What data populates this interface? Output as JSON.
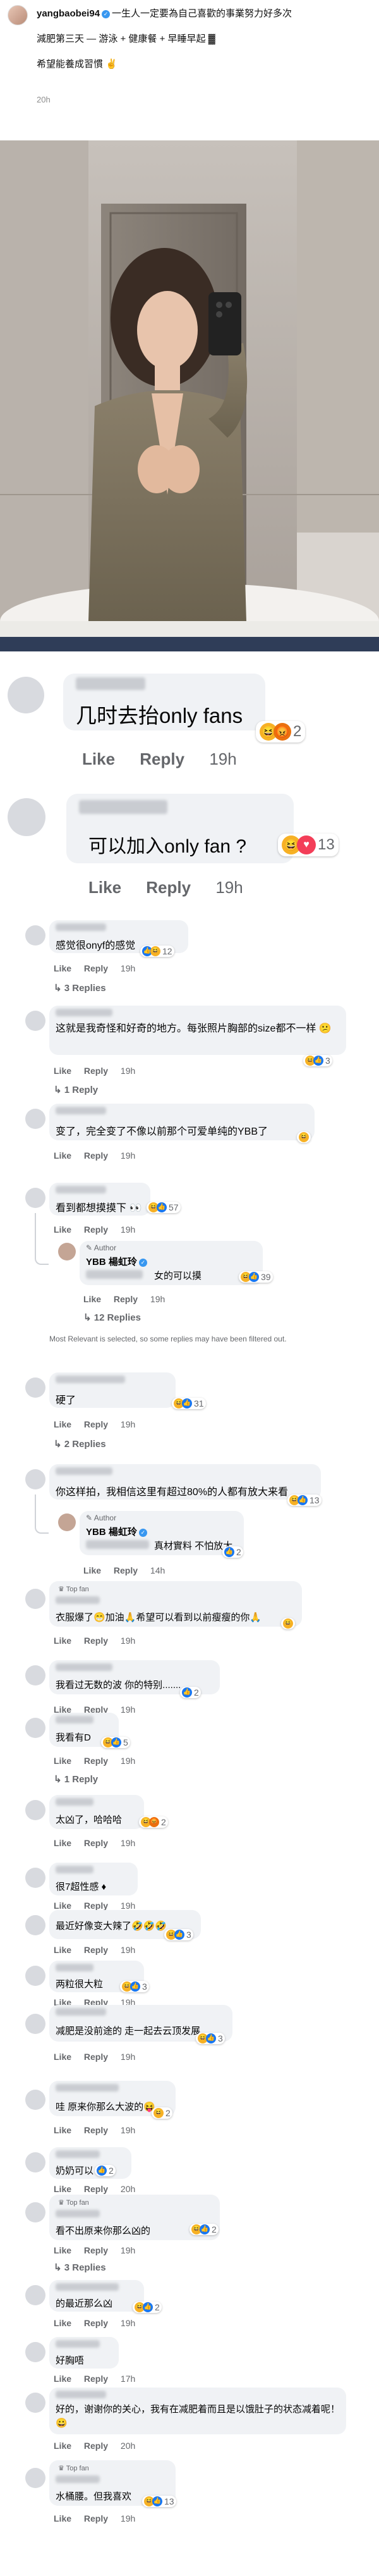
{
  "instagram_post": {
    "username": "yangbaobei94",
    "caption_line1": "一生人一定要為自己喜歡的事業努力好多次",
    "caption_line2": "減肥第三天 — 游泳 + 健康餐 + 早睡早起 ▓",
    "caption_line3": "希望能養成習慣 ✌",
    "time": "20h"
  },
  "labels": {
    "like": "Like",
    "reply": "Reply"
  },
  "comments": [
    {
      "text": "几时去抬only fans",
      "time": "19h",
      "count": "2"
    },
    {
      "text": "可以加入only fan ?",
      "time": "19h",
      "count": "13"
    },
    {
      "text": "感觉很onyf的感觉",
      "time": "19h",
      "count": "12",
      "replies": "3 Replies"
    },
    {
      "text": "这就是我奇怪和好奇的地方。每张照片胸部的size都不一样 😕",
      "time": "19h",
      "count": "3",
      "replies": "1 Reply"
    },
    {
      "text": "变了，完全变了不像以前那个可爱单纯的YBB了",
      "time": "19h",
      "count": ""
    },
    {
      "text": "看到都想摸摸下 👀",
      "time": "19h",
      "count": "57"
    },
    {
      "author": "Author",
      "name": "YBB 楊虹玲",
      "text": "女的可以摸",
      "time": "19h",
      "count": "39",
      "replies": "12 Replies"
    },
    {
      "note": "Most Relevant is selected, so some replies may have been filtered out."
    },
    {
      "text": "硬了",
      "time": "19h",
      "count": "31",
      "replies": "2 Replies"
    },
    {
      "text": "你这样拍，我相信这里有超过80%的人都有放大来看",
      "time": "19h",
      "count": "13"
    },
    {
      "author": "Author",
      "name": "YBB 楊虹玲",
      "text": "真材實料 不怕放大",
      "time": "14h",
      "count": "2"
    },
    {
      "badge": "Top fan",
      "text": "衣服爆了😁加油🙏希望可以看到以前瘦瘦的你🙏",
      "time": "19h",
      "count": ""
    },
    {
      "text": "我看过无数的波 你的特别.......",
      "time": "19h",
      "count": "2"
    },
    {
      "text": "我看有D",
      "time": "19h",
      "count": "5",
      "replies": "1 Reply"
    },
    {
      "text": "太凶了，哈哈哈",
      "time": "19h",
      "count": "2"
    },
    {
      "text": "很7超性感 ♦",
      "time": "19h",
      "count": ""
    },
    {
      "text": "最近好像变大辣了🤣🤣🤣",
      "time": "19h",
      "count": "3"
    },
    {
      "text": "两粒很大粒",
      "time": "19h",
      "count": "3"
    },
    {
      "text": "减肥是没前途的 走一起去云顶发展",
      "time": "19h",
      "count": "3"
    },
    {
      "text": "哇 原来你那么大波的😝",
      "time": "19h",
      "count": "2"
    },
    {
      "text": "奶奶可以",
      "time": "20h",
      "count": "2"
    },
    {
      "badge": "Top fan",
      "text": "看不出原来你那么凶的",
      "time": "19h",
      "count": "2",
      "replies": "3 Replies"
    },
    {
      "text": "的最近那么凶",
      "time": "19h",
      "count": "2"
    },
    {
      "text": "好胸唔",
      "time": "17h",
      "count": ""
    },
    {
      "text": "好的，谢谢你的关心，我有在减肥着而且是以饿肚子的状态减着呢！😀",
      "time": "20h",
      "count": ""
    },
    {
      "badge": "Top fan",
      "text": "水桶腰。但我喜欢",
      "time": "19h",
      "count": "13"
    }
  ]
}
